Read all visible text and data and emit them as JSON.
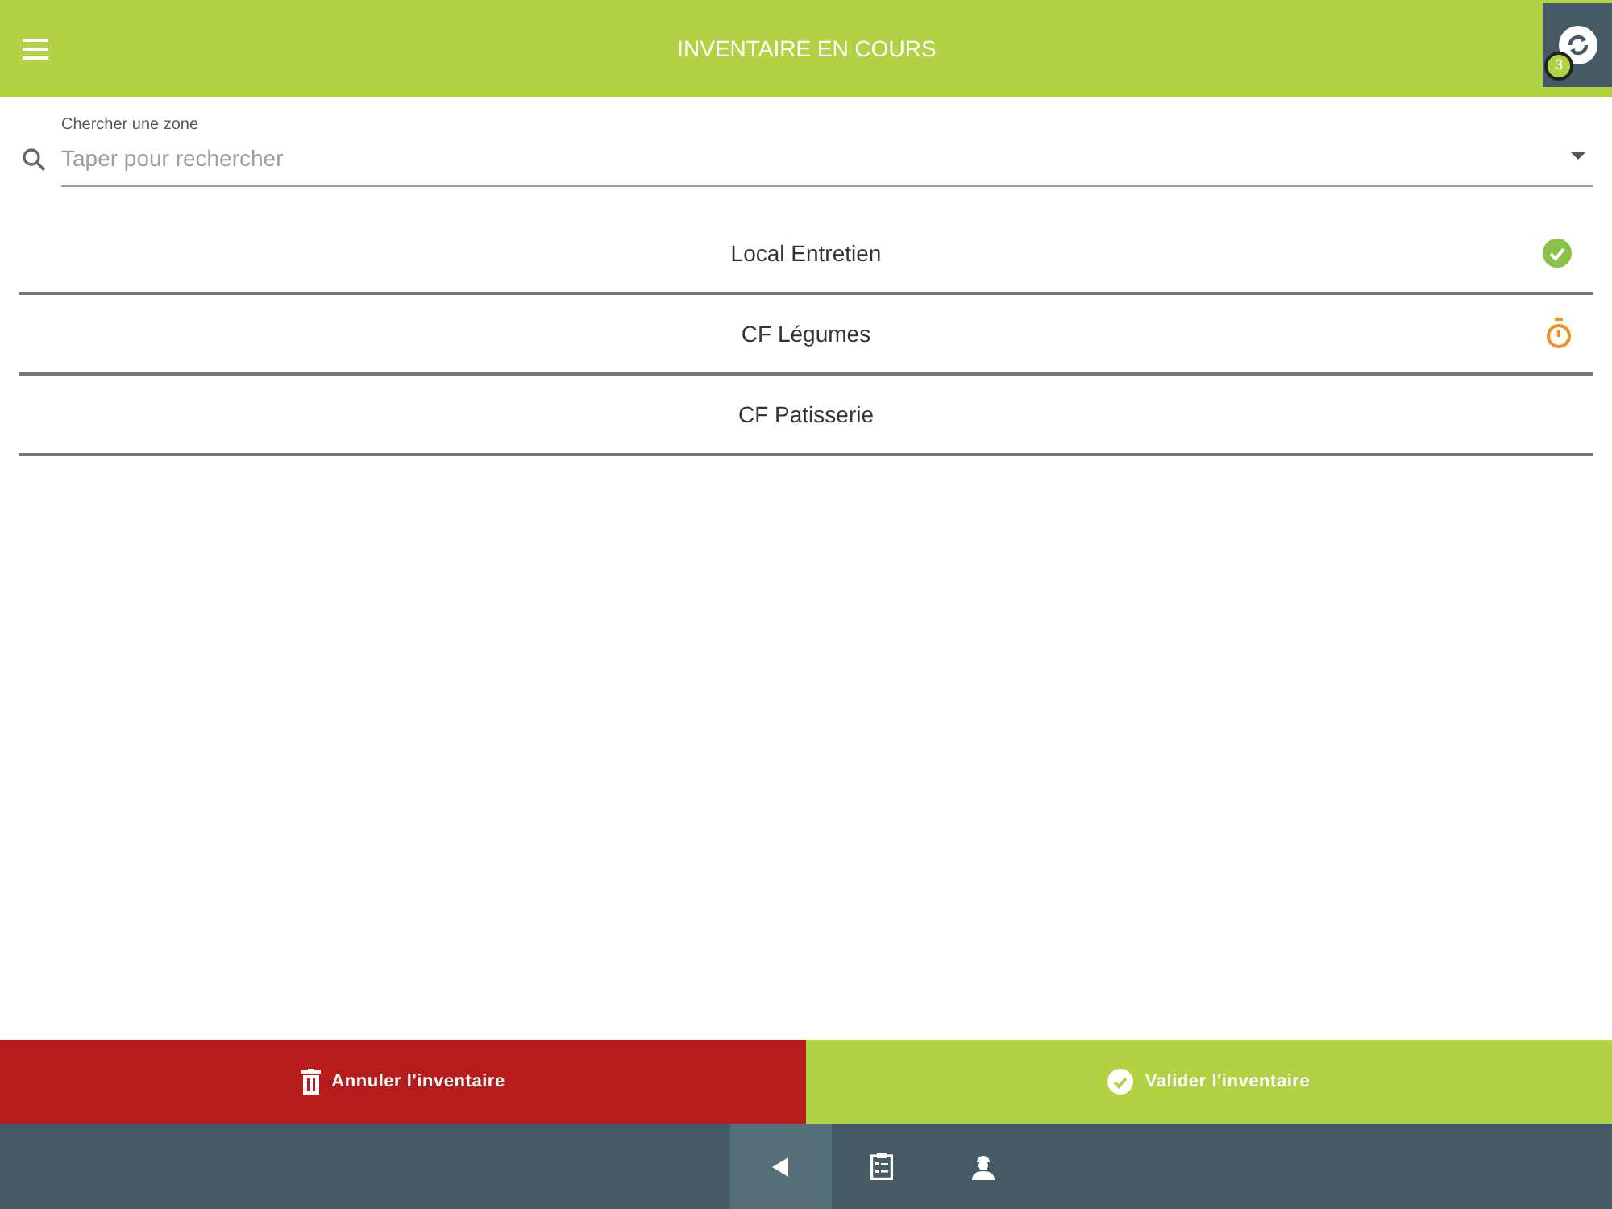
{
  "header": {
    "title": "INVENTAIRE EN COURS",
    "sync_count": "3"
  },
  "search": {
    "label": "Chercher une zone",
    "placeholder": "Taper pour rechercher"
  },
  "zones": [
    {
      "name": "Local Entretien",
      "kind": "done"
    },
    {
      "name": "CF Légumes",
      "kind": "ongoing"
    },
    {
      "name": "CF Patisserie",
      "kind": "plain"
    }
  ],
  "actions": [
    {
      "kind": "cancel",
      "label": "Annuler l'inventaire"
    },
    {
      "kind": "validate",
      "label": "Valider l'inventaire"
    }
  ],
  "nav": [
    {
      "kind": "back",
      "selected": true
    },
    {
      "kind": "clipboard",
      "selected": false
    },
    {
      "kind": "worker",
      "selected": false
    }
  ]
}
